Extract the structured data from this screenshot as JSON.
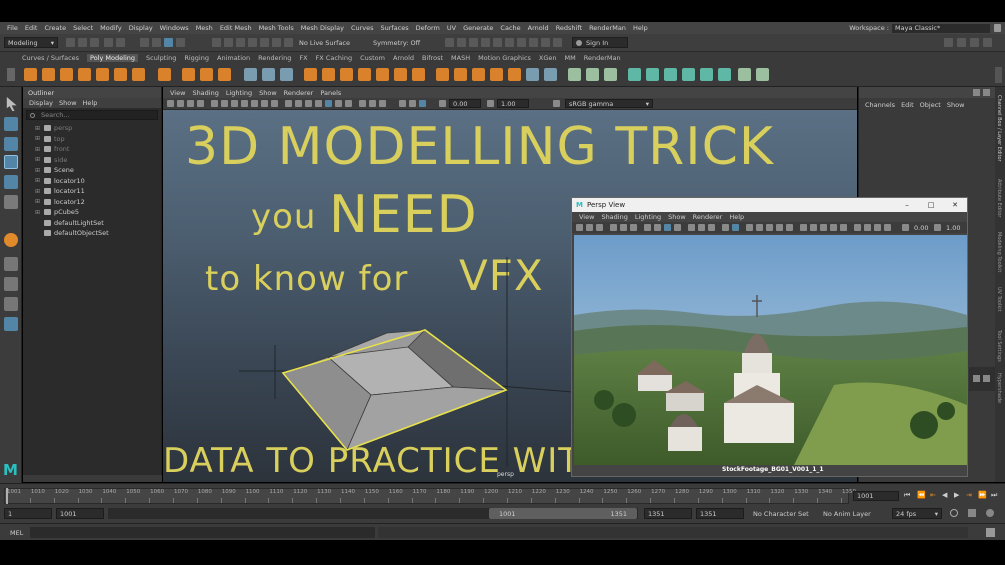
{
  "menubar": {
    "items": [
      "File",
      "Edit",
      "Create",
      "Select",
      "Modify",
      "Display",
      "Windows",
      "Mesh",
      "Edit Mesh",
      "Mesh Tools",
      "Mesh Display",
      "Curves",
      "Surfaces",
      "Deform",
      "UV",
      "Generate",
      "Cache",
      "Arnold",
      "Redshift",
      "RenderMan",
      "Help"
    ],
    "workspace_label": "Workspace :",
    "workspace_value": "Maya Classic*"
  },
  "statusline": {
    "mode": "Modeling",
    "live_surface": "No Live Surface",
    "symmetry": "Symmetry: Off",
    "sign_in": "Sign In"
  },
  "shelf_tabs": {
    "items": [
      "Curves / Surfaces",
      "Poly Modeling",
      "Sculpting",
      "Rigging",
      "Animation",
      "Rendering",
      "FX",
      "FX Caching",
      "Custom",
      "Arnold",
      "Bifrost",
      "MASH",
      "Motion Graphics",
      "XGen",
      "MM",
      "RenderMan"
    ],
    "active": "Poly Modeling"
  },
  "outliner": {
    "title": "Outliner",
    "menu": [
      "Display",
      "Show",
      "Help"
    ],
    "search_placeholder": "Search...",
    "items": [
      {
        "label": "persp",
        "dim": true,
        "plus": true
      },
      {
        "label": "top",
        "dim": true,
        "plus": true
      },
      {
        "label": "front",
        "dim": true,
        "plus": true
      },
      {
        "label": "side",
        "dim": true,
        "plus": true
      },
      {
        "label": "Scene",
        "dim": false,
        "plus": true
      },
      {
        "label": "locator10",
        "dim": false,
        "plus": true
      },
      {
        "label": "locator11",
        "dim": false,
        "plus": true
      },
      {
        "label": "locator12",
        "dim": false,
        "plus": true
      },
      {
        "label": "pCube5",
        "dim": false,
        "plus": true
      },
      {
        "label": "defaultLightSet",
        "dim": false,
        "plus": false
      },
      {
        "label": "defaultObjectSet",
        "dim": false,
        "plus": false
      }
    ]
  },
  "viewport": {
    "menu": [
      "View",
      "Shading",
      "Lighting",
      "Show",
      "Renderer",
      "Panels"
    ],
    "exposure": "0.00",
    "gamma": "1.00",
    "color_space": "sRGB gamma",
    "camera_label": "persp",
    "headline1": "3D MODELLING TRICK",
    "headline2a": "you",
    "headline2b": "NEED",
    "headline3a": "to know for",
    "headline3b": "VFX",
    "headline4": "FREE DATA TO PRACTICE WITH"
  },
  "channel_box": {
    "menu": [
      "Channels",
      "Edit",
      "Object",
      "Show"
    ],
    "side_tabs": [
      "Channel Box / Layer Editor",
      "Attribute Editor",
      "Modeling Toolkit",
      "UV Toolkit",
      "Tool Settings",
      "Hypershade"
    ]
  },
  "persp_window": {
    "title": "Persp View",
    "menu": [
      "View",
      "Shading",
      "Lighting",
      "Show",
      "Renderer",
      "Help"
    ],
    "exposure": "0.00",
    "gamma": "1.00",
    "footage_label": "StockFootage_BG01_V001_1_1"
  },
  "timeline": {
    "ticks": [
      "1001",
      "1010",
      "1020",
      "1030",
      "1040",
      "1050",
      "1060",
      "1070",
      "1080",
      "1090",
      "1100",
      "1110",
      "1120",
      "1130",
      "1140",
      "1150",
      "1160",
      "1170",
      "1180",
      "1190",
      "1200",
      "1210",
      "1220",
      "1230",
      "1240",
      "1250",
      "1260",
      "1270",
      "1280",
      "1290",
      "1300",
      "1310",
      "1320",
      "1330",
      "1340",
      "1350"
    ],
    "current_frame": "1001"
  },
  "range": {
    "start": "1",
    "anim_start": "1001",
    "range_start": "1001",
    "range_end": "1351",
    "anim_end": "1351",
    "end": "1351",
    "character_set": "No Character Set",
    "anim_layer": "No Anim Layer",
    "fps": "24 fps"
  },
  "command_line": {
    "lang": "MEL"
  },
  "colors": {
    "headline": "#d9cf5d",
    "accent_blue": "#5285a6",
    "shelf_orange": "#d9822b"
  }
}
